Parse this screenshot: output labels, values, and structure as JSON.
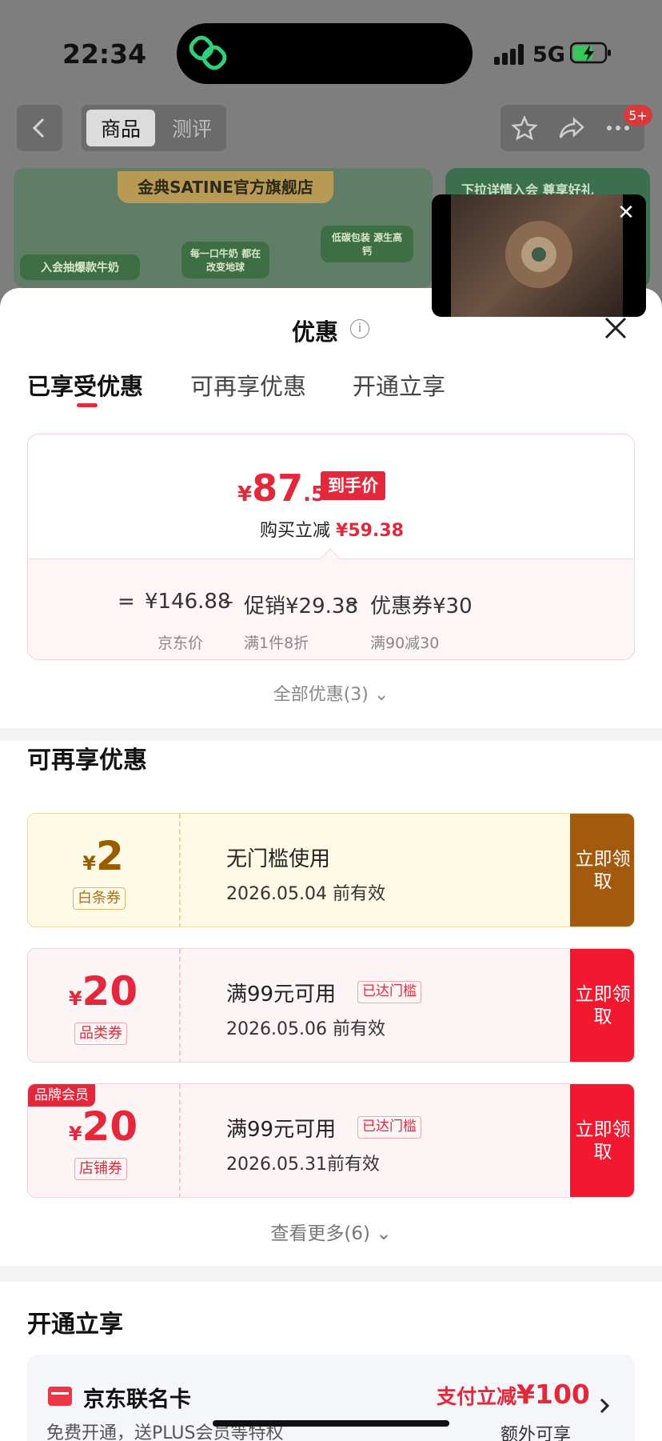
{
  "status_bar": {
    "time": "22:34",
    "network": "5G"
  },
  "header": {
    "tabs": [
      {
        "label": "商品"
      },
      {
        "label": "测评"
      }
    ],
    "badge": "5+"
  },
  "banner": {
    "shop_name": "金典SATINE官方旗舰店",
    "chip_1": "入会抽爆款牛奶",
    "chip_2": "每一口牛奶 都在改变地球",
    "chip_3": "低碳包装 源生高钙",
    "side_text": "下拉详情入会 尊享好礼"
  },
  "sheet": {
    "title": "优惠",
    "tabs": [
      {
        "label": "已享受优惠"
      },
      {
        "label": "可再享优惠"
      },
      {
        "label": "开通立享"
      }
    ],
    "final_price": {
      "currency": "¥",
      "integer": "87",
      "decimal": ".5",
      "tag": "到手价"
    },
    "instant_reduce": {
      "label": "购买立减",
      "amount": "¥59.38"
    },
    "breakdown": {
      "eq": "=",
      "jd_price": "¥146.88",
      "jd_price_label": "京东价",
      "minus_1": "–",
      "promo": "促销¥29.38",
      "promo_label": "满1件8折",
      "minus_2": "–",
      "coupon": "优惠券¥30",
      "coupon_label": "满90减30"
    },
    "all_offers": "全部优惠(3)",
    "more_section_title": "可再享优惠",
    "coupons": [
      {
        "currency": "¥",
        "value": "2",
        "type": "白条券",
        "condition": "无门槛使用",
        "date": "2026.05.04 前有效",
        "button": "立即领取",
        "color": "#a45a0e"
      },
      {
        "currency": "¥",
        "value": "20",
        "type": "品类券",
        "condition": "满99元可用",
        "reached": "已达门槛",
        "date": "2026.05.06 前有效",
        "button": "立即领取",
        "color": "#f2182f"
      },
      {
        "currency": "¥",
        "value": "20",
        "type": "店铺券",
        "tag": "品牌会员",
        "condition": "满99元可用",
        "reached": "已达门槛",
        "date": "2026.05.31前有效",
        "button": "立即领取",
        "color": "#f2182f"
      }
    ],
    "see_more": "查看更多(6)",
    "open_section_title": "开通立享",
    "card": {
      "name": "京东联名卡",
      "desc": "免费开通，送PLUS会员等特权",
      "promo_label": "支付立减",
      "promo_amount": "¥100",
      "extra": "额外可享"
    }
  },
  "colors": {
    "accent_red": "#e4283b",
    "baitiao_brown": "#a45a0e"
  }
}
